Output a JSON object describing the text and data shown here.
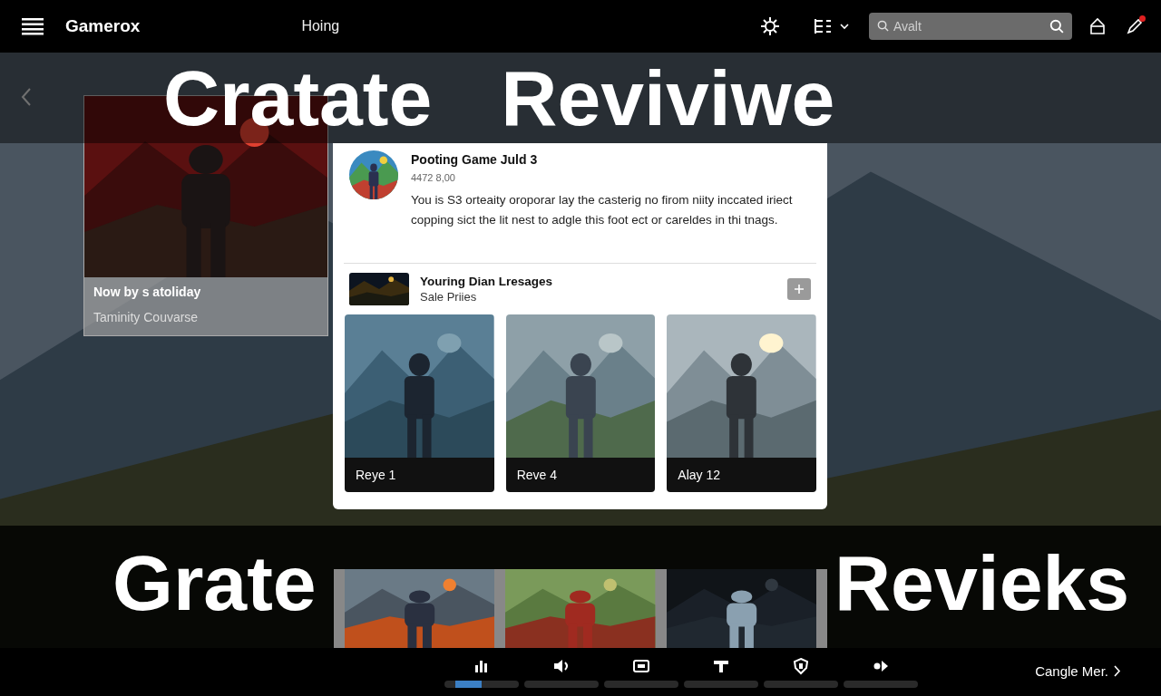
{
  "header": {
    "title": "Gamerox",
    "nav_label": "Hoing",
    "search": {
      "placeholder": "Avalt"
    },
    "notification": true
  },
  "hero": {
    "headline": [
      "Cratate",
      "Reviviwe"
    ]
  },
  "feature_card": {
    "title": "Now by s atoliday",
    "subtitle": "Taminity Couvarse"
  },
  "post": {
    "title": "Pooting Game Juld 3",
    "meta": "4472 8,00",
    "body": "You is S3 orteaity oroporar lay the casterig no firom niity inccated iriect copping sict the lit nest to adgle this foot ect or careldes in thi tnags."
  },
  "list_item": {
    "title": "Youring Dian Lresages",
    "subtitle": "Sale Priies"
  },
  "tiles": [
    {
      "label": "Reye 1"
    },
    {
      "label": "Reve 4"
    },
    {
      "label": "Alay 12"
    }
  ],
  "lower": {
    "headline": [
      "Grate",
      "Revieks"
    ]
  },
  "dock": [
    {
      "kind": "chart",
      "selected": true
    },
    {
      "kind": "sound",
      "selected": false
    },
    {
      "kind": "card",
      "selected": false
    },
    {
      "kind": "tool",
      "selected": false
    },
    {
      "kind": "shield",
      "selected": false
    },
    {
      "kind": "play",
      "selected": false
    }
  ],
  "more_link": "Cangle Mer."
}
